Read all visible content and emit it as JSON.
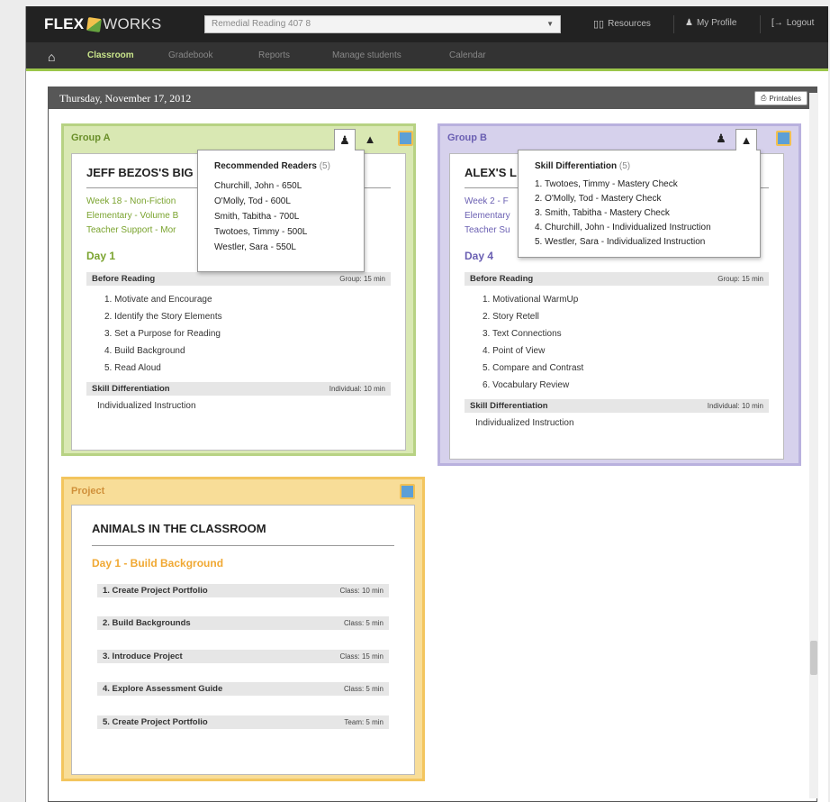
{
  "app": {
    "brand_a": "FLEX",
    "brand_b": "WORKS"
  },
  "class_select": {
    "value": "Remedial Reading 407 8"
  },
  "top_nav": {
    "resources": "Resources",
    "profile": "My Profile",
    "logout": "Logout"
  },
  "nav": {
    "tabs": [
      "Classroom",
      "Gradebook",
      "Reports",
      "Manage students",
      "Calendar"
    ],
    "active": "Classroom"
  },
  "date": "Thursday, November 17, 2012",
  "printables": "Printables",
  "colors": {
    "group_a": "#d9e8b3",
    "group_b": "#d6d1ec",
    "project": "#f8dd98",
    "accent": "#9bc64a"
  },
  "group_a": {
    "title": "Group A",
    "card_title": "JEFF BEZOS'S BIG",
    "meta": [
      "Week 18 - Non-Fiction",
      "Elementary - Volume B",
      "Teacher Support - Mor"
    ],
    "day": "Day 1",
    "before_reading": "Before Reading",
    "before_time": "Group: 15 min",
    "steps": [
      "1. Motivate and Encourage",
      "2. Identify the Story Elements",
      "3. Set a Purpose for Reading",
      "4. Build Background",
      "5. Read Aloud"
    ],
    "skill": "Skill Differentiation",
    "skill_time": "Individual: 10 min",
    "skill_item": "Individualized Instruction",
    "popover": {
      "title": "Recommended Readers",
      "count": "(5)",
      "lines": [
        "Churchill, John - 650L",
        "O'Molly, Tod - 600L",
        "Smith, Tabitha - 700L",
        "Twotoes, Timmy - 500L",
        "Westler, Sara - 550L"
      ]
    }
  },
  "group_b": {
    "title": "Group B",
    "card_title": "ALEX'S L",
    "meta": [
      "Week 2 - F",
      "Elementary",
      "Teacher Su"
    ],
    "day": "Day 4",
    "before_reading": "Before Reading",
    "before_time": "Group: 15 min",
    "steps": [
      "1. Motivational WarmUp",
      "2. Story Retell",
      "3. Text Connections",
      "4. Point of View",
      "5. Compare and Contrast",
      "6. Vocabulary Review"
    ],
    "skill": "Skill Differentiation",
    "skill_time": "Individual: 10 min",
    "skill_item": "Individualized Instruction",
    "popover": {
      "title": "Skill Differentiation",
      "count": "(5)",
      "lines": [
        "1. Twotoes, Timmy - Mastery Check",
        "2. O'Molly, Tod - Mastery Check",
        "3. Smith, Tabitha - Mastery Check",
        "4. Churchill, John - Individualized Instruction",
        "5. Westler, Sara - Individualized Instruction"
      ]
    }
  },
  "project": {
    "title": "Project",
    "card_title": "ANIMALS IN THE CLASSROOM",
    "day": "Day 1 - Build Background",
    "steps": [
      {
        "label": "1. Create Project Portfolio",
        "time": "Class: 10 min"
      },
      {
        "label": "2. Build Backgrounds",
        "time": "Class: 5 min"
      },
      {
        "label": "3. Introduce Project",
        "time": "Class: 15 min"
      },
      {
        "label": "4. Explore Assessment Guide",
        "time": "Class: 5 min"
      },
      {
        "label": "5. Create Project Portfolio",
        "time": "Team: 5 min"
      }
    ]
  }
}
